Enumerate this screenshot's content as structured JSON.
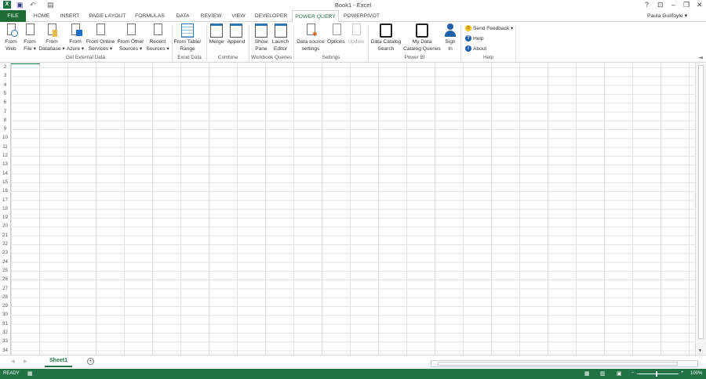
{
  "window": {
    "title": "Book1 - Excel",
    "help": "?",
    "restore_ribbon": "⊡",
    "minimize": "–",
    "maximize": "❐",
    "close": "✕"
  },
  "tabs": [
    "FILE",
    "HOME",
    "INSERT",
    "PAGE LAYOUT",
    "FORMULAS",
    "DATA",
    "REVIEW",
    "VIEW",
    "DEVELOPER",
    "POWER QUERY",
    "POWERPIVOT"
  ],
  "user": "Paula Guilfoyle ▾",
  "ribbon": {
    "buttons": [
      {
        "l1": "From",
        "l2": "Web"
      },
      {
        "l1": "From",
        "l2": "File ▾"
      },
      {
        "l1": "From",
        "l2": "Database ▾"
      },
      {
        "l1": "From",
        "l2": "Azure ▾"
      },
      {
        "l1": "From Online",
        "l2": "Services ▾"
      },
      {
        "l1": "From Other",
        "l2": "Sources ▾"
      },
      {
        "l1": "Recent",
        "l2": "Sources ▾"
      },
      {
        "l1": "From Table/",
        "l2": "Range"
      },
      {
        "l1": "Merge",
        "l2": ""
      },
      {
        "l1": "Append",
        "l2": ""
      },
      {
        "l1": "Show",
        "l2": "Pane"
      },
      {
        "l1": "Launch",
        "l2": "Editor"
      },
      {
        "l1": "Data source",
        "l2": "settings"
      },
      {
        "l1": "Options",
        "l2": ""
      },
      {
        "l1": "Update",
        "l2": ""
      },
      {
        "l1": "Data Catalog",
        "l2": "Search"
      },
      {
        "l1": "My Data",
        "l2": "Catalog Queries"
      },
      {
        "l1": "Sign",
        "l2": "In"
      }
    ],
    "groups": [
      "Get External Data",
      "Excel Data",
      "Combine",
      "Workbook Queries",
      "Settings",
      "Power BI",
      "Help"
    ],
    "help_items": [
      "Send Feedback ▾",
      "Help",
      "About"
    ]
  },
  "rows": [
    "2",
    "3",
    "4",
    "5",
    "6",
    "7",
    "8",
    "9",
    "10",
    "11",
    "12",
    "13",
    "14",
    "15",
    "16",
    "17",
    "18",
    "19",
    "20",
    "21",
    "22",
    "23",
    "24",
    "25",
    "26",
    "27",
    "28",
    "29",
    "30",
    "31",
    "32",
    "33",
    "34"
  ],
  "sheets": [
    "Sheet1"
  ],
  "status": {
    "ready": "READY",
    "zoom": "100%"
  }
}
